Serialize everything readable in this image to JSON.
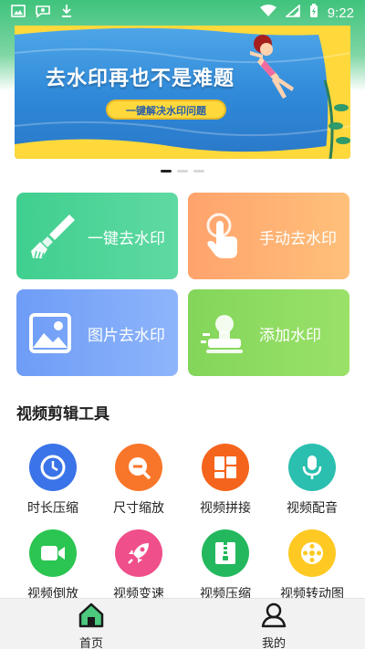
{
  "status_bar": {
    "icons": [
      "image-icon",
      "chat-bug-icon",
      "download-icon",
      "wifi-icon",
      "signal-icon",
      "battery-charging-icon"
    ],
    "time": "9:22"
  },
  "banner": {
    "title": "去水印再也不是难题",
    "button_label": "一键解决水印问题",
    "page_count": 3,
    "active_page": 1
  },
  "features": [
    {
      "label": "一键去水印",
      "icon": "brush-icon",
      "color": "#46d193"
    },
    {
      "label": "手动去水印",
      "icon": "hand-tap-icon",
      "color": "#ffab70"
    },
    {
      "label": "图片去水印",
      "icon": "picture-icon",
      "color": "#7aa5f8"
    },
    {
      "label": "添加水印",
      "icon": "stamp-icon",
      "color": "#8adb60"
    }
  ],
  "tools_section": {
    "title": "视频剪辑工具",
    "items": [
      {
        "label": "时长压缩",
        "icon": "clock-icon",
        "color": "#3b73e8"
      },
      {
        "label": "尺寸缩放",
        "icon": "zoom-out-icon",
        "color": "#f8762a"
      },
      {
        "label": "视频拼接",
        "icon": "grid-icon",
        "color": "#f5641c"
      },
      {
        "label": "视频配音",
        "icon": "microphone-icon",
        "color": "#2bbfaf"
      },
      {
        "label": "视频倒放",
        "icon": "video-camera-icon",
        "color": "#2bc552"
      },
      {
        "label": "视频变速",
        "icon": "rocket-icon",
        "color": "#ef4f8a"
      },
      {
        "label": "视频压缩",
        "icon": "archive-icon",
        "color": "#23b85d"
      },
      {
        "label": "视频转动图",
        "icon": "film-reel-icon",
        "color": "#ffc923"
      }
    ]
  },
  "bottom_nav": {
    "items": [
      {
        "label": "首页",
        "icon": "home-icon",
        "active": true
      },
      {
        "label": "我的",
        "icon": "person-icon",
        "active": false
      }
    ]
  }
}
